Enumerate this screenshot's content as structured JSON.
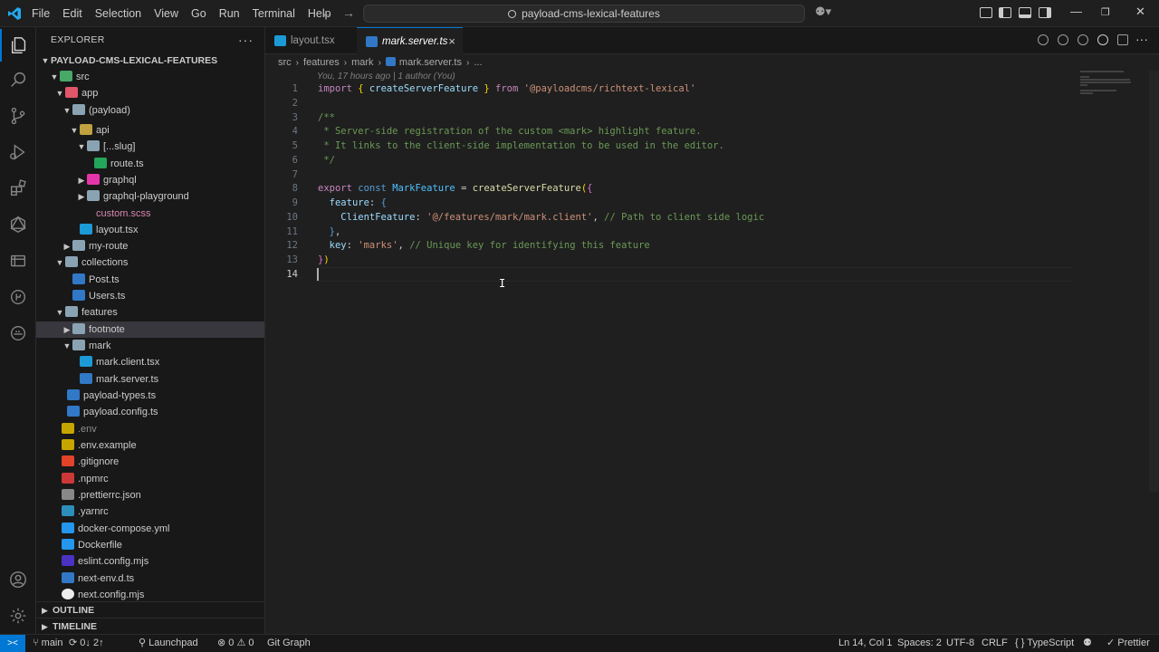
{
  "titlebar": {
    "menu": [
      "File",
      "Edit",
      "Selection",
      "View",
      "Go",
      "Run",
      "Terminal",
      "Help"
    ],
    "search": "payload-cms-lexical-features",
    "colors": {
      "accent": "#0078d4"
    }
  },
  "activity": [
    "explorer-icon",
    "search-icon",
    "source-control-icon",
    "run-debug-icon",
    "extensions-icon",
    "graphql-icon",
    "database-icon",
    "gitlens-icon",
    "docker-icon",
    "account-icon",
    "manage-icon"
  ],
  "sidebar": {
    "title": "EXPLORER",
    "more": "···",
    "project": "PAYLOAD-CMS-LEXICAL-FEATURES",
    "tree": [
      {
        "label": "src"
      },
      {
        "label": "app"
      },
      {
        "label": "(payload)"
      },
      {
        "label": "api"
      },
      {
        "label": "[...slug]"
      },
      {
        "label": "route.ts"
      },
      {
        "label": "graphql"
      },
      {
        "label": "graphql-playground"
      },
      {
        "label": "custom.scss"
      },
      {
        "label": "layout.tsx"
      },
      {
        "label": "my-route"
      },
      {
        "label": "collections"
      },
      {
        "label": "Post.ts"
      },
      {
        "label": "Users.ts"
      },
      {
        "label": "features"
      },
      {
        "label": "footnote"
      },
      {
        "label": "mark"
      },
      {
        "label": "mark.client.tsx"
      },
      {
        "label": "mark.server.ts"
      },
      {
        "label": "payload-types.ts"
      },
      {
        "label": "payload.config.ts"
      },
      {
        "label": ".env"
      },
      {
        "label": ".env.example"
      },
      {
        "label": ".gitignore"
      },
      {
        "label": ".npmrc"
      },
      {
        "label": ".prettierrc.json"
      },
      {
        "label": ".yarnrc"
      },
      {
        "label": "docker-compose.yml"
      },
      {
        "label": "Dockerfile"
      },
      {
        "label": "eslint.config.mjs"
      },
      {
        "label": "next-env.d.ts"
      },
      {
        "label": "next.config.mjs"
      }
    ],
    "outline": "OUTLINE",
    "timeline": "TIMELINE"
  },
  "tabs": [
    {
      "label": "layout.tsx"
    },
    {
      "label": "mark.server.ts",
      "close": "×"
    }
  ],
  "breadcrumb": {
    "parts": [
      "src",
      "features",
      "mark",
      "mark.server.ts",
      "..."
    ],
    "sep": "›"
  },
  "editor": {
    "blame": "You, 17 hours ago | 1 author (You)",
    "line_numbers": [
      "1",
      "2",
      "3",
      "4",
      "5",
      "6",
      "7",
      "8",
      "9",
      "10",
      "11",
      "12",
      "13",
      "14"
    ]
  },
  "statusbar": {
    "branch": "main",
    "sync": "0↓ 2↑",
    "launchpad": "Launchpad",
    "problems": "⊗ 0 ⚠ 0",
    "gitgraph": "Git Graph",
    "position": "Ln 14, Col 1",
    "spaces": "Spaces: 2",
    "encoding": "UTF-8",
    "eol": "CRLF",
    "language": "{ } TypeScript",
    "prettier": "✓ Prettier"
  }
}
